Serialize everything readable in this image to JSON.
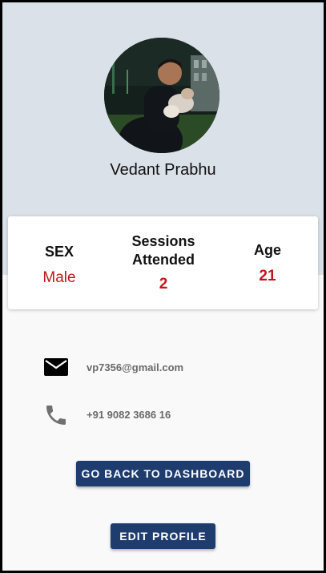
{
  "profile": {
    "name": "Vedant Prabhu"
  },
  "stats": {
    "sex_label": "SEX",
    "sex_value": "Male",
    "sessions_label_line1": "Sessions",
    "sessions_label_line2": "Attended",
    "sessions_value": "2",
    "age_label": "Age",
    "age_value": "21"
  },
  "contact": {
    "email": "vp7356@gmail.com",
    "email_icon": "mail-icon",
    "phone": "+91 9082 3686 16",
    "phone_icon": "phone-icon"
  },
  "actions": {
    "dashboard_label": "GO BACK TO DASHBOARD",
    "edit_label": "EDIT PROFILE"
  },
  "colors": {
    "header_bg": "#dae1e9",
    "accent_red": "#c0161c",
    "button_blue": "#1e3d6e"
  }
}
